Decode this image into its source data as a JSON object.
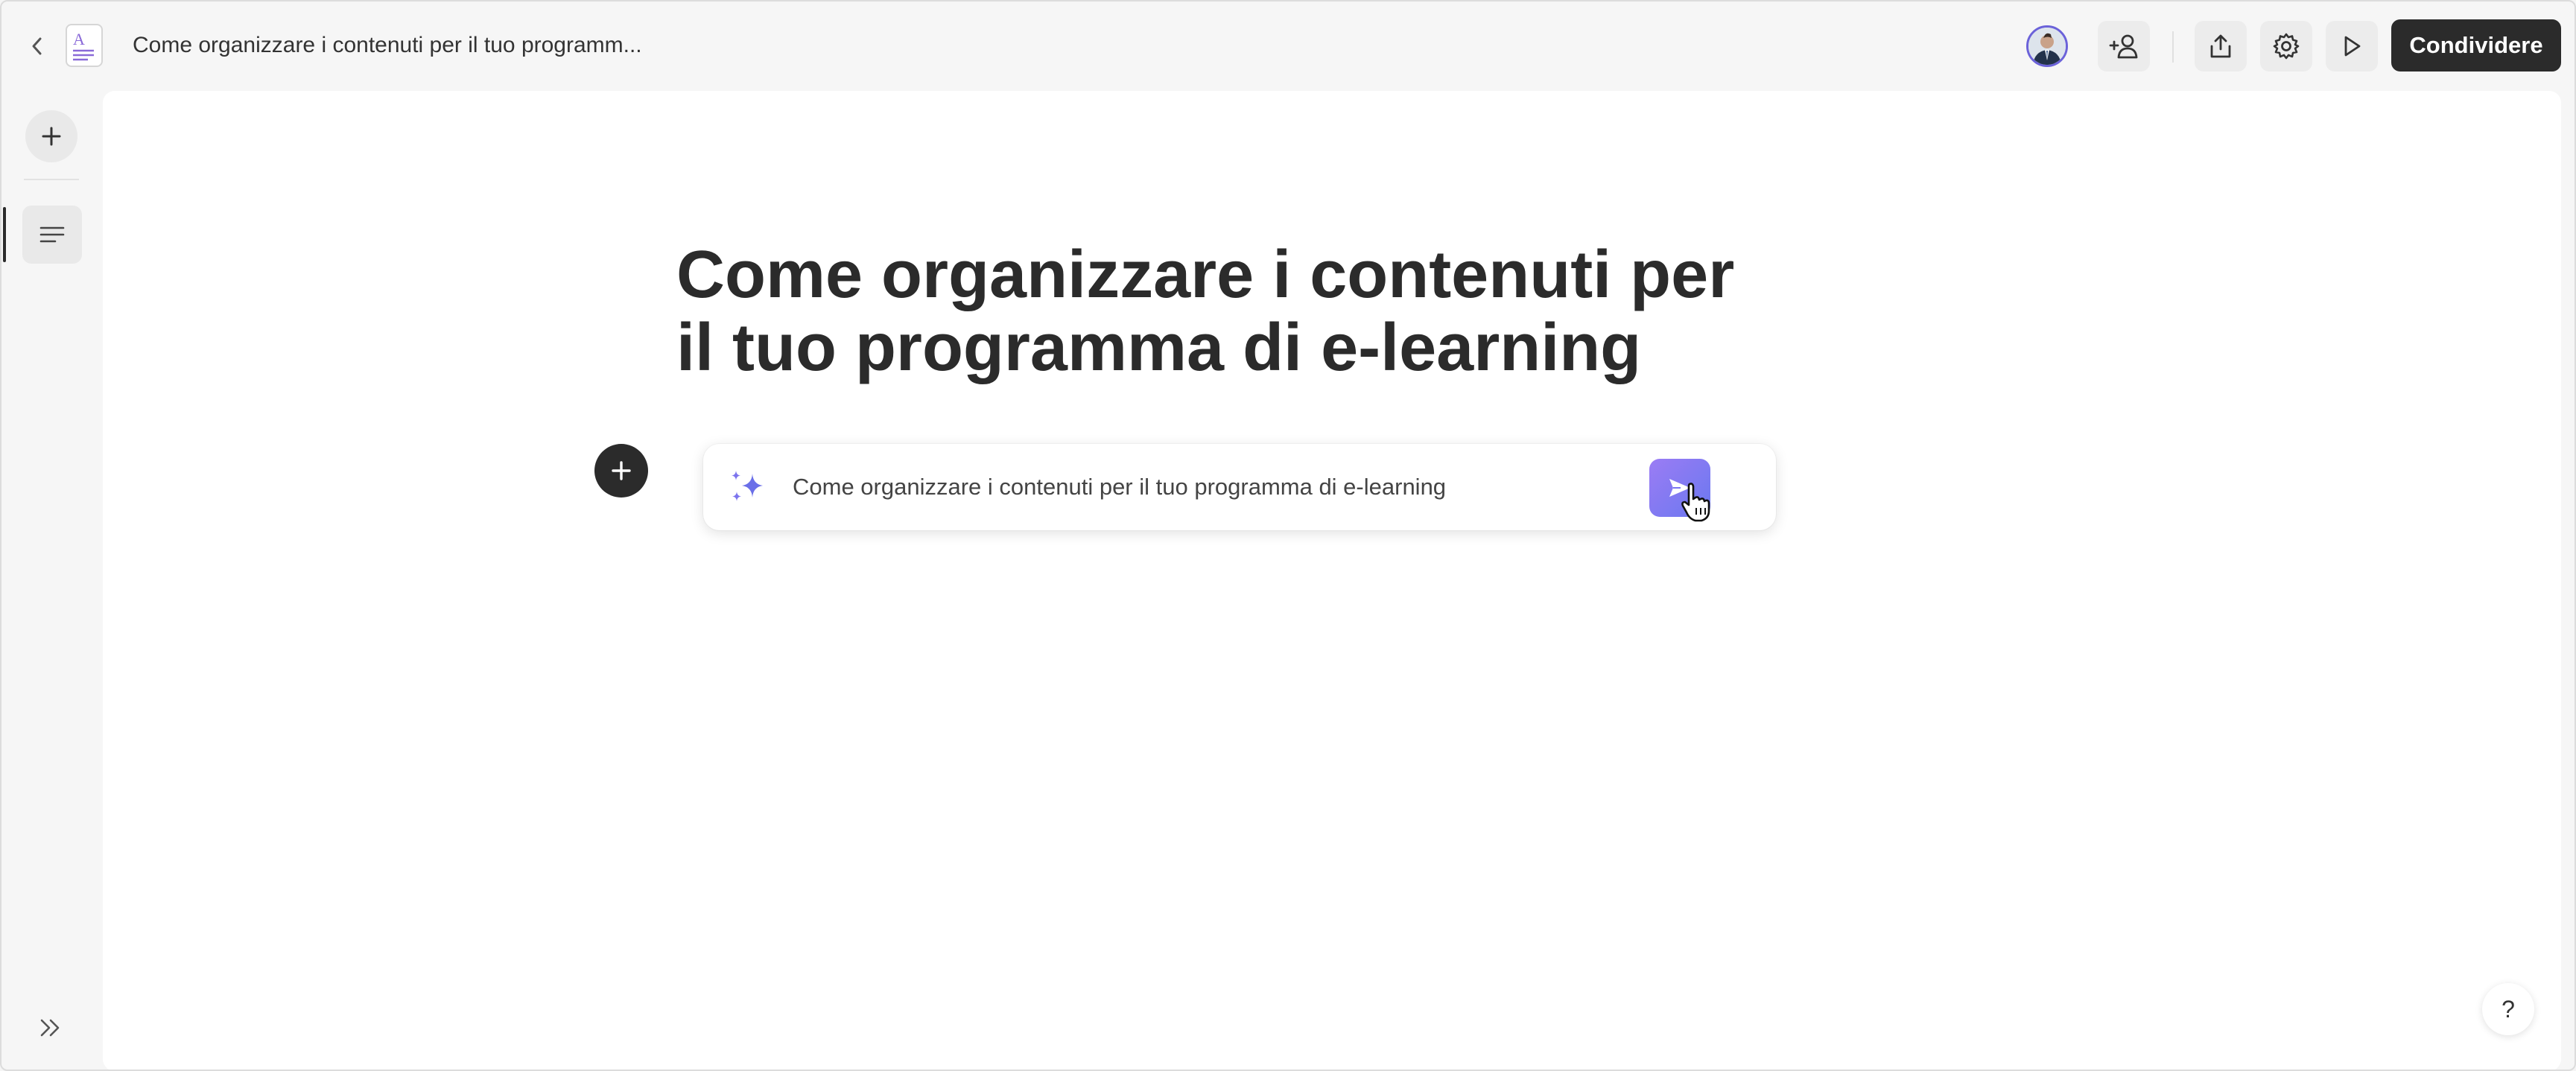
{
  "header": {
    "document_title": "Come organizzare i contenuti per il tuo programm...",
    "share_label": "Condividere"
  },
  "icons": {
    "back": "chevron-left-icon",
    "document": "document-icon",
    "add_collaborator": "add-user-icon",
    "export": "upload-icon",
    "settings": "gear-icon",
    "present": "play-icon",
    "new_page": "plus-icon",
    "outline": "list-icon",
    "expand": "chevrons-right-icon",
    "help": "question-icon",
    "sparkle": "sparkle-icon",
    "send": "send-icon"
  },
  "document": {
    "heading_line1": "Come organizzare i contenuti per",
    "heading_line2": "il tuo programma di e-learning"
  },
  "ai_prompt": {
    "value": "Come organizzare i contenuti per il tuo programma di e-learning"
  },
  "help": {
    "label": "?"
  },
  "colors": {
    "accent": "#7b76f2",
    "primary_dark": "#2b2b2b",
    "avatar_ring": "#6b62d9"
  }
}
